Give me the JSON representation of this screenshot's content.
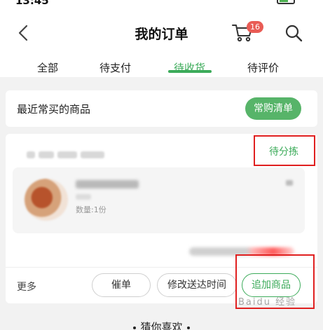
{
  "status_bar": {
    "time": "13:45"
  },
  "header": {
    "title": "我的订单",
    "cart_badge": "16",
    "icons": {
      "back": "chevron-left-icon",
      "cart": "cart-icon",
      "search": "search-icon"
    }
  },
  "tabs": [
    {
      "label": "全部",
      "active": false
    },
    {
      "label": "待支付",
      "active": false
    },
    {
      "label": "待收货",
      "active": true
    },
    {
      "label": "待评价",
      "active": false
    }
  ],
  "frequent": {
    "label": "最近常买的商品",
    "button": "常购清单"
  },
  "order": {
    "status": "待分拣",
    "product": {
      "quantity": "数量:1份"
    },
    "actions": {
      "more": "更多",
      "urge": "催单",
      "change_time": "修改送达时间",
      "add_items": "追加商品"
    }
  },
  "footer": {
    "guess_title": "猜你喜欢"
  },
  "watermark": "Baidu 经验",
  "colors": {
    "accent_green": "#3cab5a",
    "badge_red": "#e95c55",
    "highlight_red": "#e02020"
  }
}
